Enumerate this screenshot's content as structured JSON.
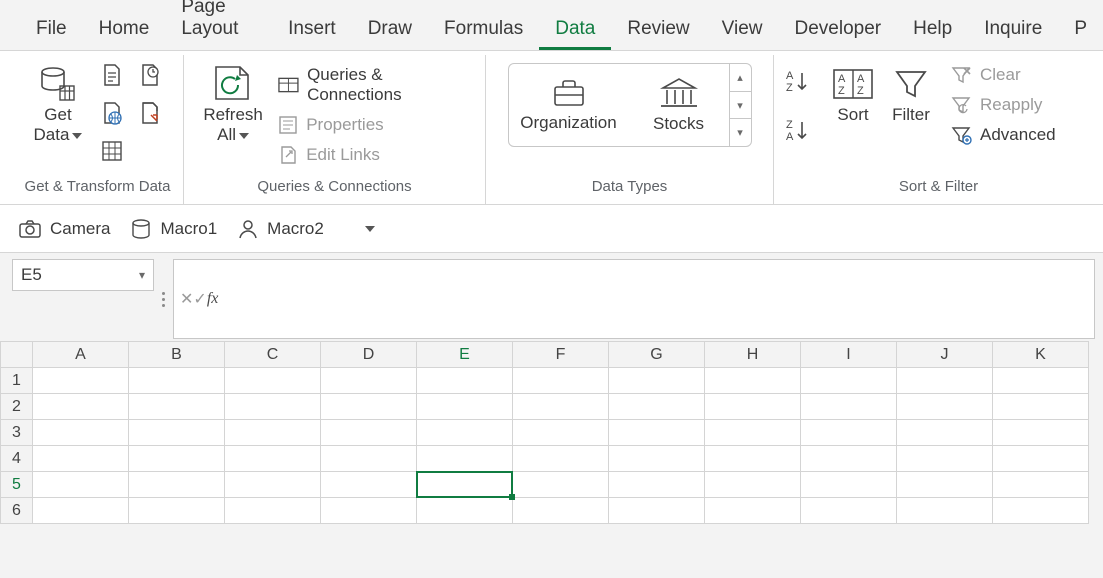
{
  "tabs": [
    "File",
    "Home",
    "Page Layout",
    "Insert",
    "Draw",
    "Formulas",
    "Data",
    "Review",
    "View",
    "Developer",
    "Help",
    "Inquire",
    "P"
  ],
  "active_tab": "Data",
  "ribbon": {
    "get_data": {
      "label1": "Get",
      "label2": "Data",
      "group": "Get & Transform Data"
    },
    "refresh": {
      "label1": "Refresh",
      "label2": "All",
      "group": "Queries & Connections",
      "queries": "Queries & Connections",
      "properties": "Properties",
      "editlinks": "Edit Links"
    },
    "datatypes": {
      "group": "Data Types",
      "org": "Organization",
      "stocks": "Stocks"
    },
    "sortfilter": {
      "group": "Sort & Filter",
      "sort": "Sort",
      "filter": "Filter",
      "clear": "Clear",
      "reapply": "Reapply",
      "advanced": "Advanced"
    }
  },
  "quick": {
    "camera": "Camera",
    "macro1": "Macro1",
    "macro2": "Macro2"
  },
  "namebox": "E5",
  "formula": "",
  "columns": [
    "A",
    "B",
    "C",
    "D",
    "E",
    "F",
    "G",
    "H",
    "I",
    "J",
    "K"
  ],
  "rows": [
    "1",
    "2",
    "3",
    "4",
    "5",
    "6"
  ],
  "selected_col": "E",
  "selected_row": "5"
}
